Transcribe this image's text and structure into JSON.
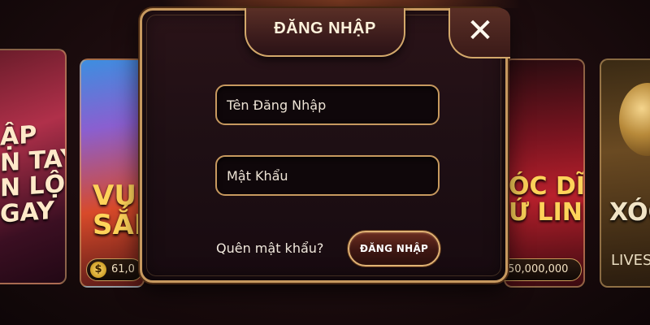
{
  "background": {
    "left_card_1_text": "ẬP\nN TAY\nN LỘC\nGAY",
    "left_card_2_text": "VU\nSẮN",
    "left_card_2_jackpot_symbol": "$",
    "left_card_2_jackpot": "61,0",
    "right_card_1_text": "ÓC DĨA\nỨ LINH",
    "right_card_1_jackpot": "50,000,000",
    "right_card_2_text": "XÓC",
    "right_card_2_subtext": "LIVES"
  },
  "login_modal": {
    "title": "ĐĂNG NHẬP",
    "close_icon": "close-icon",
    "close_glyph": "✕",
    "username_placeholder": "Tên Đăng Nhập",
    "username_value": "",
    "password_placeholder": "Mật Khẩu",
    "password_value": "",
    "forgot_password_label": "Quên mật khẩu?",
    "submit_label": "ĐĂNG NHẬP"
  },
  "colors": {
    "gold_border": "#c7995f",
    "modal_background": "#1e0f14",
    "field_background": "#0f070a",
    "text_light": "#fff3dc"
  }
}
